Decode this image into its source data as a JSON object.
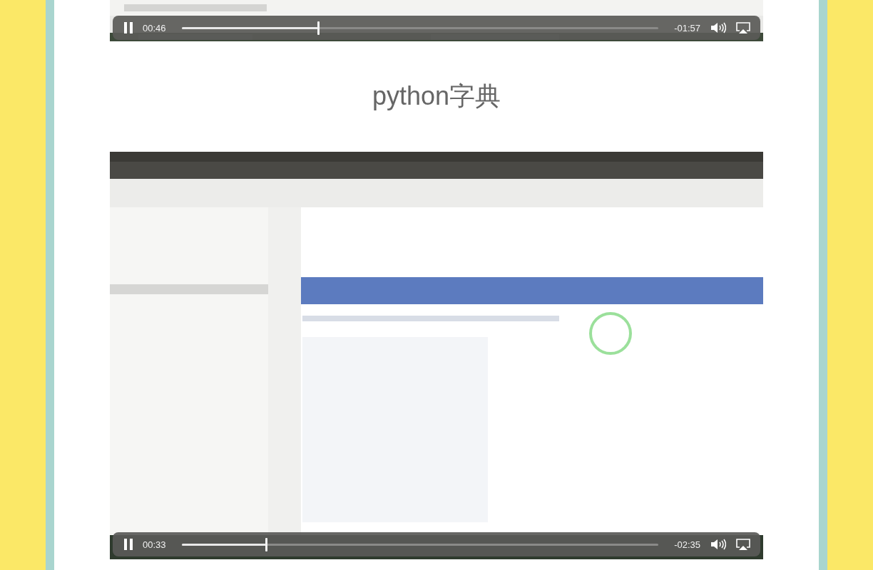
{
  "videos_before": [
    {
      "kind": "picture",
      "playing": true,
      "elapsed": "00:46",
      "remaining": "-01:57",
      "level": 0.287
    }
  ],
  "heading": "python字典",
  "videos_after": [
    {
      "kind": "picture",
      "playing": true,
      "elapsed": "00:33",
      "remaining": "-02:35",
      "level": 0.177
    }
  ]
}
